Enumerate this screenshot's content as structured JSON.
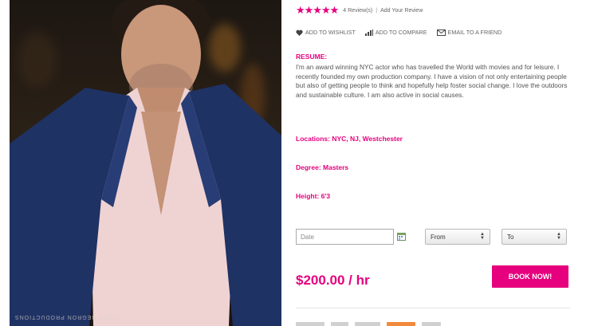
{
  "rating": {
    "stars": "★★★★★",
    "reviews": "4 Review(s)",
    "separator": "|",
    "add_review": "Add Your Review"
  },
  "actions": {
    "wishlist": "ADD TO WISHLIST",
    "compare": "ADD TO COMPARE",
    "email": "EMAIL TO A FRIEND"
  },
  "resume": {
    "title": "RESUME:",
    "text": "I'm an award winning NYC actor who has travelled the World with movies and for leisure. I recently founded my own production company. I have a vision of not only entertaining people but also of getting people to think and hopefully help foster social change. I love the outdoors and sustainable culture. I am also active in social causes."
  },
  "details": {
    "locations": "Locations: NYC, NJ, Westchester",
    "degree": "Degree: Masters",
    "height": "Height: 6'3"
  },
  "booking": {
    "date_placeholder": "Date",
    "from_value": "From",
    "to_value": "To",
    "price": "$200.00 / hr",
    "book_label": "BOOK NOW!"
  },
  "photo": {
    "watermark": "SOFIA NEGRON PRODUCTIONS"
  },
  "colors": {
    "accent": "#e6007e",
    "text": "#555555"
  }
}
